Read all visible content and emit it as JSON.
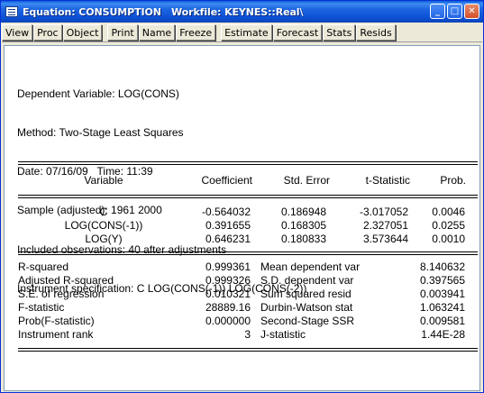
{
  "window": {
    "title": "Equation: CONSUMPTION   Workfile: KEYNES::Real\\",
    "buttons": {
      "minimize": "_",
      "maximize": "□",
      "close": "✕"
    }
  },
  "toolbar": {
    "group1": [
      "View",
      "Proc",
      "Object"
    ],
    "group2": [
      "Print",
      "Name",
      "Freeze"
    ],
    "group3": [
      "Estimate",
      "Forecast",
      "Stats",
      "Resids"
    ]
  },
  "header": {
    "dependent": "Dependent Variable: LOG(CONS)",
    "method": "Method: Two-Stage Least Squares",
    "date": "Date: 07/16/09   Time: 11:39",
    "sample": "Sample (adjusted): 1961 2000",
    "observations": "Included observations: 40 after adjustments",
    "instruments": "Instrument specification: C LOG(CONS(-1)) LOG(CONS(-2))"
  },
  "coef_table": {
    "columns": [
      "Variable",
      "Coefficient",
      "Std. Error",
      "t-Statistic",
      "Prob."
    ],
    "rows": [
      [
        "C",
        "-0.564032",
        "0.186948",
        "-3.017052",
        "0.0046"
      ],
      [
        "LOG(CONS(-1))",
        "0.391655",
        "0.168305",
        "2.327051",
        "0.0255"
      ],
      [
        "LOG(Y)",
        "0.646231",
        "0.180833",
        "3.573644",
        "0.0010"
      ]
    ]
  },
  "stats_table": {
    "rows": [
      [
        "R-squared",
        "0.999361",
        "Mean dependent var",
        "8.140632"
      ],
      [
        "Adjusted R-squared",
        "0.999326",
        "S.D. dependent var",
        "0.397565"
      ],
      [
        "S.E. of regression",
        "0.010321",
        "Sum squared resid",
        "0.003941"
      ],
      [
        "F-statistic",
        "28889.16",
        "Durbin-Watson stat",
        "1.063241"
      ],
      [
        "Prob(F-statistic)",
        "0.000000",
        "Second-Stage SSR",
        "0.009581"
      ],
      [
        "Instrument rank",
        "3",
        "J-statistic",
        "1.44E-28"
      ]
    ]
  }
}
